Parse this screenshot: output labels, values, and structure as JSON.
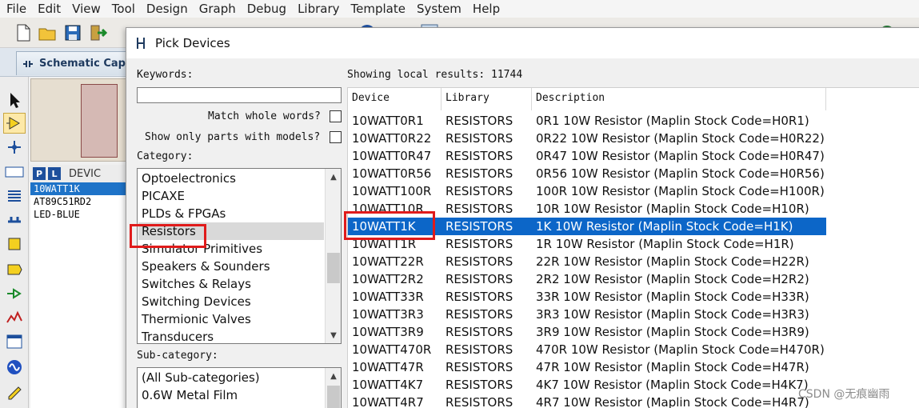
{
  "menu": [
    "File",
    "Edit",
    "View",
    "Tool",
    "Design",
    "Graph",
    "Debug",
    "Library",
    "Template",
    "System",
    "Help"
  ],
  "tab": {
    "label": "Schematic Capt"
  },
  "device_panel": {
    "p_badge": "P",
    "l_badge": "L",
    "header": "DEVIC",
    "devices": [
      "10WATT1K",
      "AT89C51RD2",
      "LED-BLUE"
    ],
    "selected_index": 0
  },
  "dialog": {
    "title": "Pick Devices",
    "keywords_label": "Keywords:",
    "keywords_value": "",
    "match_whole_words": "Match whole words?",
    "show_only_models": "Show only parts with models?",
    "category_label": "Category:",
    "categories": [
      "Optoelectronics",
      "PICAXE",
      "PLDs & FPGAs",
      "Resistors",
      "Simulator Primitives",
      "Speakers & Sounders",
      "Switches & Relays",
      "Switching Devices",
      "Thermionic Valves",
      "Transducers"
    ],
    "selected_category": "Resistors",
    "subcategory_label": "Sub-category:",
    "subcategories": [
      "(All Sub-categories)",
      "0.6W Metal Film"
    ],
    "results_summary": "Showing local results: 11744",
    "columns": [
      "Device",
      "Library",
      "Description"
    ],
    "rows": [
      [
        "10WATT0R1",
        "RESISTORS",
        "0R1 10W Resistor (Maplin Stock Code=H0R1)"
      ],
      [
        "10WATT0R22",
        "RESISTORS",
        "0R22 10W Resistor (Maplin Stock Code=H0R22)"
      ],
      [
        "10WATT0R47",
        "RESISTORS",
        "0R47 10W Resistor (Maplin Stock Code=H0R47)"
      ],
      [
        "10WATT0R56",
        "RESISTORS",
        "0R56 10W Resistor (Maplin Stock Code=H0R56)"
      ],
      [
        "10WATT100R",
        "RESISTORS",
        "100R 10W Resistor (Maplin Stock Code=H100R)"
      ],
      [
        "10WATT10R",
        "RESISTORS",
        "10R 10W Resistor (Maplin Stock Code=H10R)"
      ],
      [
        "10WATT1K",
        "RESISTORS",
        "1K 10W Resistor (Maplin Stock Code=H1K)"
      ],
      [
        "10WATT1R",
        "RESISTORS",
        "1R 10W Resistor (Maplin Stock Code=H1R)"
      ],
      [
        "10WATT22R",
        "RESISTORS",
        "22R 10W Resistor (Maplin Stock Code=H22R)"
      ],
      [
        "10WATT2R2",
        "RESISTORS",
        "2R2 10W Resistor (Maplin Stock Code=H2R2)"
      ],
      [
        "10WATT33R",
        "RESISTORS",
        "33R 10W Resistor (Maplin Stock Code=H33R)"
      ],
      [
        "10WATT3R3",
        "RESISTORS",
        "3R3 10W Resistor (Maplin Stock Code=H3R3)"
      ],
      [
        "10WATT3R9",
        "RESISTORS",
        "3R9 10W Resistor (Maplin Stock Code=H3R9)"
      ],
      [
        "10WATT470R",
        "RESISTORS",
        "470R 10W Resistor (Maplin Stock Code=H470R)"
      ],
      [
        "10WATT47R",
        "RESISTORS",
        "47R 10W Resistor (Maplin Stock Code=H47R)"
      ],
      [
        "10WATT4K7",
        "RESISTORS",
        "4K7 10W Resistor (Maplin Stock Code=H4K7)"
      ],
      [
        "10WATT4R7",
        "RESISTORS",
        "4R7 10W Resistor (Maplin Stock Code=H4R7)"
      ]
    ],
    "selected_row": 6
  },
  "watermark": "CSDN @无痕幽雨",
  "colors": {
    "selection": "#0c66c8",
    "highlight_box": "#e01b1b",
    "badge": "#1d4f9c"
  }
}
